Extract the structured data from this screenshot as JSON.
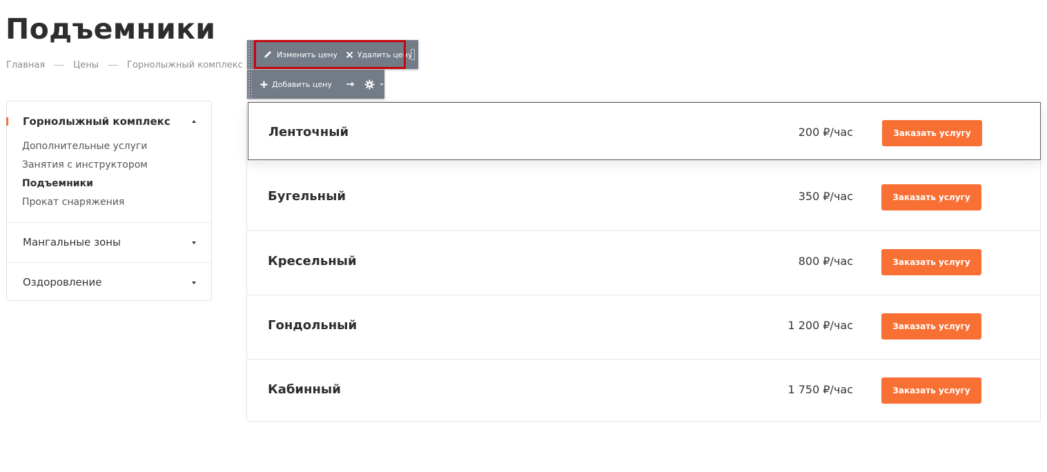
{
  "page": {
    "title": "Подъемники",
    "breadcrumb": [
      "Главная",
      "Цены",
      "Горнолыжный комплекс"
    ]
  },
  "sidebar": {
    "sections": [
      {
        "label": "Горнолыжный комплекс",
        "expanded": true,
        "items": [
          {
            "label": "Дополнительные услуги",
            "active": false
          },
          {
            "label": "Занятия с инструктором",
            "active": false
          },
          {
            "label": "Подъемники",
            "active": true
          },
          {
            "label": "Прокат снаряжения",
            "active": false
          }
        ]
      },
      {
        "label": "Мангальные зоны",
        "expanded": false
      },
      {
        "label": "Оздоровление",
        "expanded": false
      }
    ]
  },
  "prices": [
    {
      "name": "Ленточный",
      "price": "200 ₽/час",
      "button": "Заказать услугу"
    },
    {
      "name": "Бугельный",
      "price": "350 ₽/час",
      "button": "Заказать услугу"
    },
    {
      "name": "Кресельный",
      "price": "800 ₽/час",
      "button": "Заказать услугу"
    },
    {
      "name": "Гондольный",
      "price": "1 200 ₽/час",
      "button": "Заказать услугу"
    },
    {
      "name": "Кабинный",
      "price": "1 750 ₽/час",
      "button": "Заказать услугу"
    }
  ],
  "admin_toolbar": {
    "edit_label": "Изменить цену",
    "delete_label": "Удалить цену",
    "add_label": "Добавить цену"
  },
  "colors": {
    "accent": "#f87034",
    "toolbar_bg": "#737b87",
    "highlight_border": "#c4040c"
  }
}
